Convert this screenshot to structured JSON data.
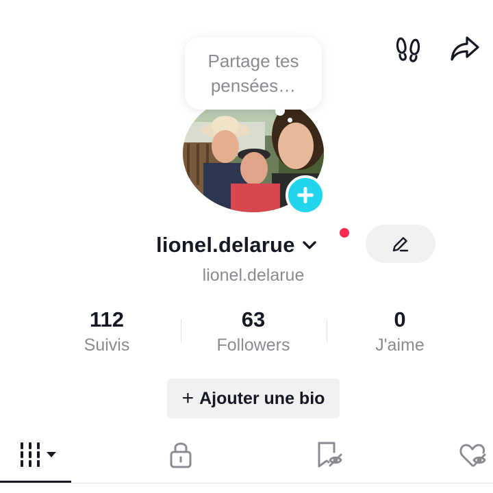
{
  "header": {
    "icons": [
      "footprints-icon",
      "share-icon"
    ]
  },
  "profile": {
    "thoughts_bubble": "Partage tes pensées…",
    "username": "lionel.delarue",
    "handle": "lionel.delarue",
    "notification_dot_color": "#fe2c55",
    "add_button_color": "#20d5ec"
  },
  "stats": [
    {
      "value": "112",
      "label": "Suivis"
    },
    {
      "value": "63",
      "label": "Followers"
    },
    {
      "value": "0",
      "label": "J'aime"
    }
  ],
  "bio_button": {
    "icon": "+",
    "label": "Ajouter une bio"
  },
  "tabs": [
    {
      "icon": "videos-grid-icon",
      "selected": true
    },
    {
      "icon": "lock-icon",
      "selected": false
    },
    {
      "icon": "saved-hidden-icon",
      "selected": false
    },
    {
      "icon": "liked-hidden-icon",
      "selected": false
    }
  ]
}
